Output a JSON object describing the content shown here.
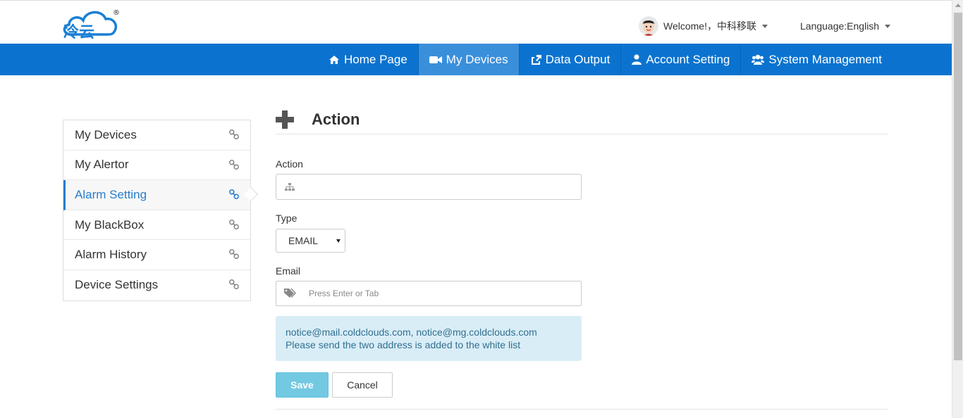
{
  "header": {
    "logo_icon": "cloud-logo-icon",
    "logo_text": "冷云",
    "logo_mark": "®",
    "welcome_text": "Welcome!，中科移联",
    "language_text": "Language:English"
  },
  "nav": {
    "items": [
      {
        "label": "Home Page",
        "icon": "home-icon"
      },
      {
        "label": "My Devices",
        "icon": "video-camera-icon",
        "active": true
      },
      {
        "label": "Data Output",
        "icon": "export-icon"
      },
      {
        "label": "Account Setting",
        "icon": "user-icon"
      },
      {
        "label": "System Management",
        "icon": "users-icon"
      }
    ]
  },
  "sidebar": {
    "items": [
      {
        "label": "My Devices"
      },
      {
        "label": "My Alertor"
      },
      {
        "label": "Alarm Setting",
        "active": true
      },
      {
        "label": "My BlackBox"
      },
      {
        "label": "Alarm History"
      },
      {
        "label": "Device Settings"
      }
    ],
    "item_icon": "link-icon"
  },
  "main": {
    "title": "Action",
    "action_label": "Action",
    "action_value": "",
    "type_label": "Type",
    "type_value": "EMAIL",
    "email_label": "Email",
    "email_placeholder": "Press Enter or Tab",
    "notice_line1": "notice@mail.coldclouds.com, notice@mg.coldclouds.com",
    "notice_line2": "Please send the two address is added to the white list",
    "save_label": "Save",
    "cancel_label": "Cancel"
  },
  "colors": {
    "nav_bg": "#0b73cf",
    "nav_active": "#3a8fdb",
    "accent": "#2a7ccb",
    "notice_bg": "#d9edf7",
    "save_bg": "#5bc0de"
  }
}
